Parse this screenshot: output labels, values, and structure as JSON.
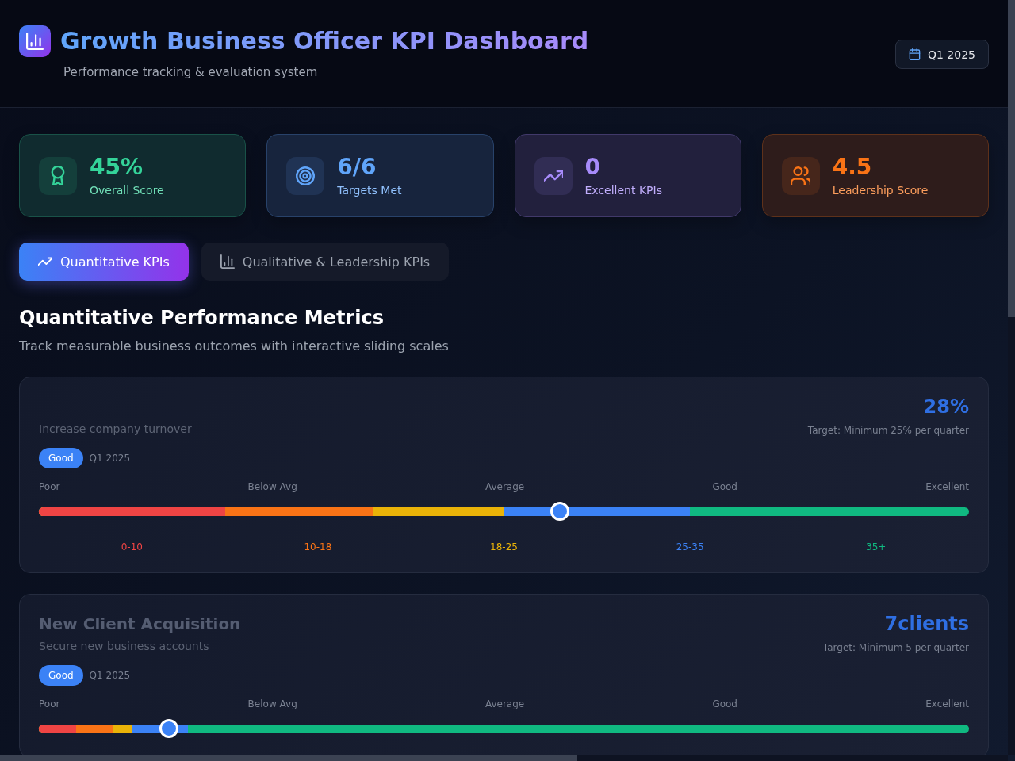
{
  "header": {
    "title": "Growth Business Officer KPI Dashboard",
    "subtitle": "Performance tracking & evaluation system",
    "period_button": "Q1 2025"
  },
  "stats": [
    {
      "value": "45%",
      "label": "Overall Score",
      "color": "#34d399",
      "kind": "award"
    },
    {
      "value": "6/6",
      "label": "Targets Met",
      "color": "#60a5fa",
      "kind": "target"
    },
    {
      "value": "0",
      "label": "Excellent KPIs",
      "color": "#a78bfa",
      "kind": "trend"
    },
    {
      "value": "4.5",
      "label": "Leadership Score",
      "color": "#f97316",
      "kind": "people"
    }
  ],
  "tabs": [
    {
      "label": "Quantitative KPIs",
      "selected": true,
      "kind": "trend"
    },
    {
      "label": "Qualitative & Leadership KPIs",
      "selected": false,
      "kind": "bars"
    }
  ],
  "section": {
    "title": "Quantitative Performance Metrics",
    "subtitle": "Track measurable business outcomes with interactive sliding scales"
  },
  "kpis": [
    {
      "description": "Increase company turnover",
      "value": "28%",
      "target": "Target: Minimum 25% per quarter",
      "badge": "Good",
      "period": "Q1 2025",
      "scale_labels": [
        "Poor",
        "Below Avg",
        "Average",
        "Good",
        "Excellent"
      ],
      "level": 0.56,
      "bands": [
        {
          "level": 0.2
        },
        {
          "level": 0.36
        },
        {
          "level": 0.5
        },
        {
          "level": 0.7
        }
      ],
      "ranges": [
        "0-10",
        "10-18",
        "18-25",
        "25-35",
        "35+"
      ]
    },
    {
      "title": "New Client Acquisition",
      "description": "Secure new business accounts",
      "value": "7clients",
      "target": "Target: Minimum 5 per quarter",
      "badge": "Good",
      "period": "Q1 2025",
      "scale_labels": [
        "Poor",
        "Below Avg",
        "Average",
        "Good",
        "Excellent"
      ],
      "level": 0.14,
      "bands": [
        {
          "level": 0.04
        },
        {
          "level": 0.08
        },
        {
          "level": 0.1
        },
        {
          "level": 0.16
        }
      ]
    }
  ]
}
